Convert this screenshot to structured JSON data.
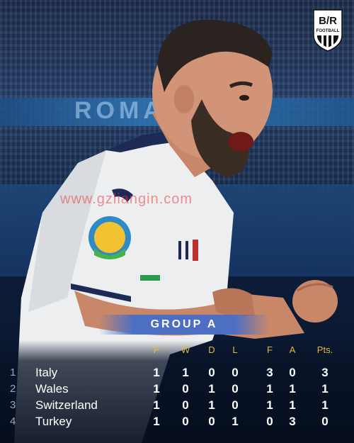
{
  "brand": {
    "line1": "B/R",
    "line2": "FOOTBALL"
  },
  "background_text": "ROMA",
  "watermark": "www.gzliangin.com",
  "group_title": "GROUP A",
  "columns": [
    "P",
    "W",
    "D",
    "L",
    "F",
    "A",
    "Pts."
  ],
  "standings": [
    {
      "rank": "1",
      "team": "Italy",
      "P": "1",
      "W": "1",
      "D": "0",
      "L": "0",
      "F": "3",
      "A": "0",
      "Pts": "3"
    },
    {
      "rank": "2",
      "team": "Wales",
      "P": "1",
      "W": "0",
      "D": "1",
      "L": "0",
      "F": "1",
      "A": "1",
      "Pts": "1"
    },
    {
      "rank": "3",
      "team": "Switzerland",
      "P": "1",
      "W": "0",
      "D": "1",
      "L": "0",
      "F": "1",
      "A": "1",
      "Pts": "1"
    },
    {
      "rank": "4",
      "team": "Turkey",
      "P": "1",
      "W": "0",
      "D": "0",
      "L": "1",
      "F": "0",
      "A": "3",
      "Pts": "0"
    }
  ],
  "colors": {
    "header": "#e3b93f",
    "banner": "#4a6ec8",
    "text": "#ffffff"
  }
}
